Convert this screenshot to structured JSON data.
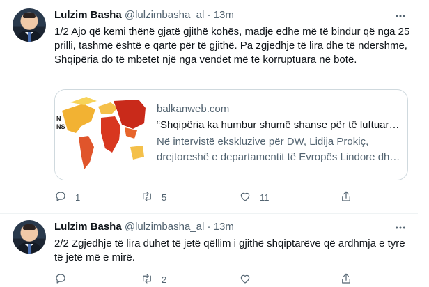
{
  "tweets": [
    {
      "name": "Lulzim Basha",
      "handle": "@lulzimbasha_al",
      "separator": "·",
      "time": "13m",
      "text": "1/2 Ajo që kemi thënë gjatë gjithë kohës, madje edhe më të bindur që nga 25 prilli, tashmë është e qartë për të gjithë. Pa zgjedhje të lira dhe të ndershme, Shqipëria do të mbetet një nga vendet më të korruptuara në botë.",
      "card": {
        "domain": "balkanweb.com",
        "title": "“Shqipëria ka humbur shumë shanse për të luftuar…",
        "description": "Në intervistë ekskluzive për DW, Lidija Prokiç, drejtoreshë e departamentit të Evropës Lindore dh…"
      },
      "actions": {
        "reply": "1",
        "retweet": "5",
        "like": "11",
        "share": ""
      }
    },
    {
      "name": "Lulzim Basha",
      "handle": "@lulzimbasha_al",
      "separator": "·",
      "time": "13m",
      "text": "2/2 Zgjedhje të lira duhet të jetë qëllim i gjithë shqiptarëve që ardhmja e tyre të jetë më e mirë.",
      "actions": {
        "reply": "",
        "retweet": "2",
        "like": "",
        "share": ""
      }
    }
  ],
  "icons": {
    "more": "more-icon",
    "reply": "reply-icon",
    "retweet": "retweet-icon",
    "like": "heart-icon",
    "share": "share-icon"
  },
  "colors": {
    "text": "#0f1419",
    "secondary": "#536471",
    "border": "#cfd9de"
  }
}
